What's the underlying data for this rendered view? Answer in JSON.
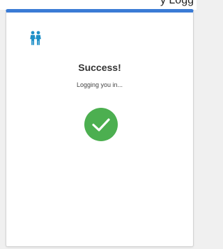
{
  "header": {
    "partial_text": "y Logg"
  },
  "colors": {
    "accent": "#3a7bd5",
    "success": "#4caf50",
    "logo": "#1e8fc7"
  },
  "card": {
    "logo_icon": "two-people-icon",
    "title": "Success!",
    "subtitle": "Logging you in...",
    "status_icon": "checkmark-circle-icon"
  }
}
